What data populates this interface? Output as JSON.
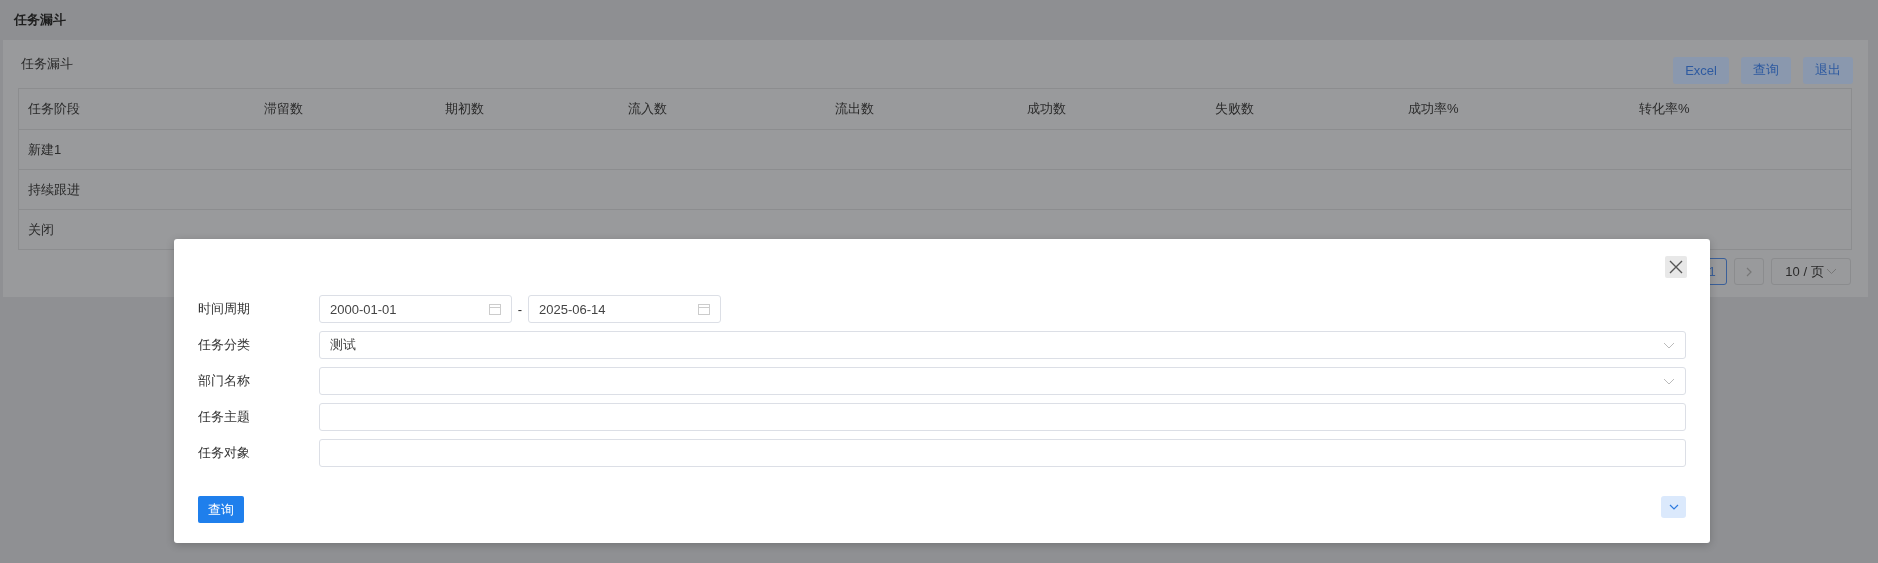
{
  "page": {
    "title": "任务漏斗"
  },
  "panel": {
    "title": "任务漏斗",
    "buttons": [
      "Excel",
      "查询",
      "退出"
    ]
  },
  "table": {
    "columns": [
      "任务阶段",
      "滞留数",
      "期初数",
      "流入数",
      "流出数",
      "成功数",
      "失败数",
      "成功率%",
      "转化率%"
    ],
    "rows": [
      {
        "stage": "新建1"
      },
      {
        "stage": "持续跟进"
      },
      {
        "stage": "关闭"
      }
    ]
  },
  "pagination": {
    "pages": [
      {
        "label": "1",
        "selected": true
      }
    ],
    "page_size": "10 / 页"
  },
  "dialog": {
    "fields": [
      {
        "kind": "date_range",
        "label": "时间周期",
        "from": "2000-01-01",
        "separator": "-",
        "to": "2025-06-14"
      },
      {
        "kind": "select",
        "label": "任务分类",
        "value": "测试"
      },
      {
        "kind": "select",
        "label": "部门名称"
      },
      {
        "kind": "text",
        "label": "任务主题"
      },
      {
        "kind": "text",
        "label": "任务对象"
      }
    ],
    "submit": "查询"
  }
}
